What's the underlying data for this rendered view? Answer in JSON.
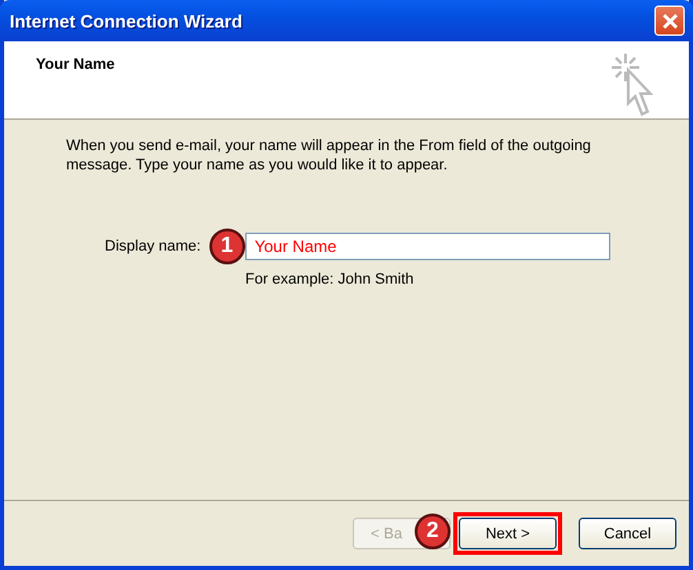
{
  "window": {
    "title": "Internet Connection Wizard"
  },
  "header": {
    "title": "Your Name"
  },
  "intro": "When you send e-mail, your name will appear in the From field of the outgoing message. Type your name as you would like it to appear.",
  "display_name": {
    "label": "Display name:",
    "value": "Your Name",
    "example": "For example: John Smith",
    "step": "1"
  },
  "buttons": [
    {
      "label": "< Ba",
      "disabled": true,
      "highlighted": false
    },
    {
      "label": "Next >",
      "disabled": false,
      "highlighted": true,
      "step": "2"
    },
    {
      "label": "Cancel",
      "disabled": false,
      "highlighted": false
    }
  ]
}
